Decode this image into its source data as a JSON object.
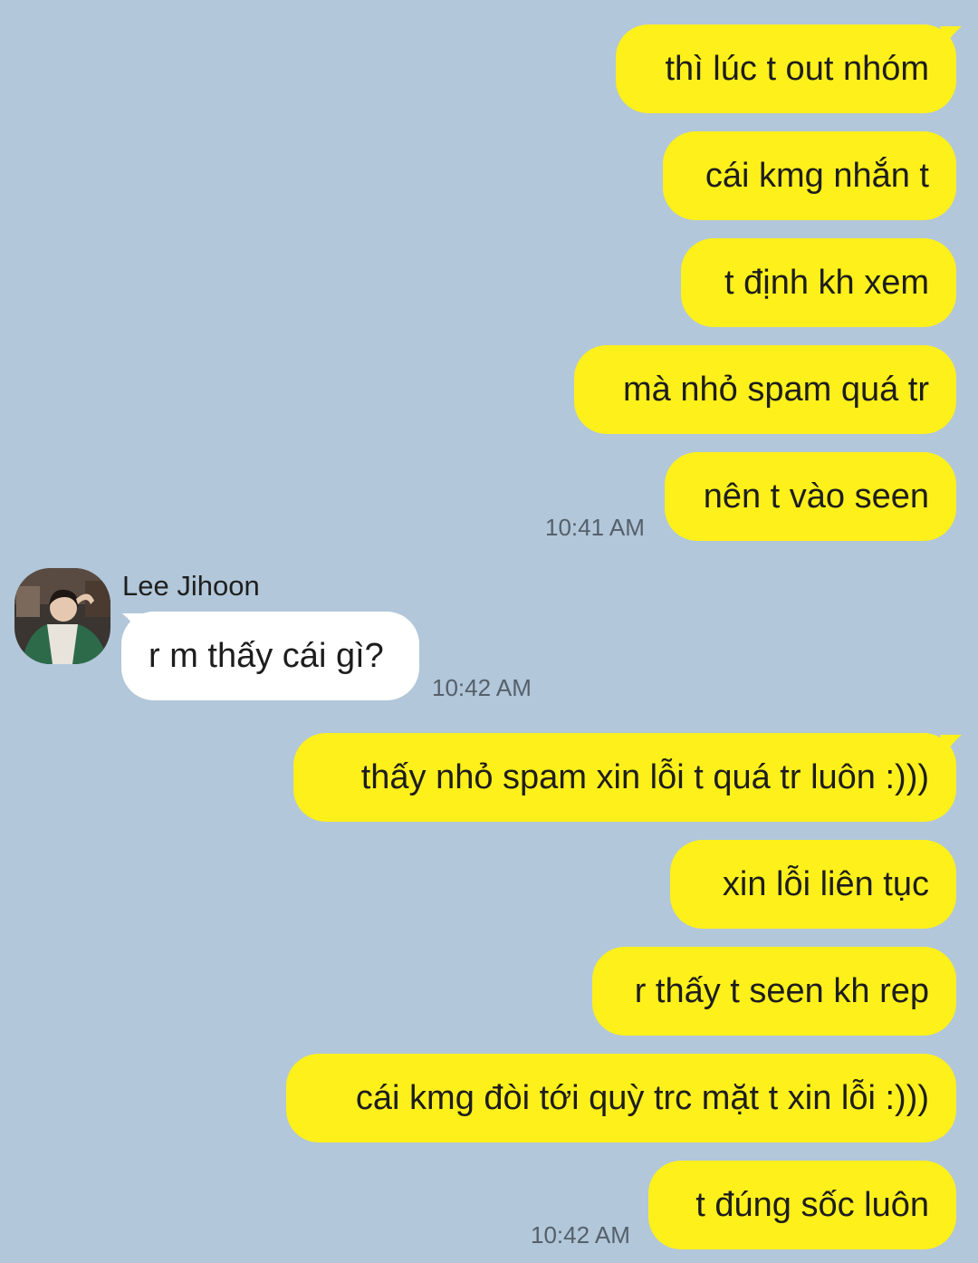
{
  "messages": [
    {
      "text": "thì lúc t out nhóm"
    },
    {
      "text": "cái kmg nhắn t"
    },
    {
      "text": "t định kh xem"
    },
    {
      "text": "mà nhỏ spam quá tr"
    },
    {
      "text": "nên t vào seen"
    },
    {
      "text": "r m thấy cái gì?"
    },
    {
      "text": "thấy nhỏ spam xin lỗi t quá tr luôn :)))"
    },
    {
      "text": "xin lỗi liên tục"
    },
    {
      "text": "r thấy t seen kh rep"
    },
    {
      "text": "cái kmg đòi tới quỳ trc mặt t xin lỗi :)))"
    },
    {
      "text": "t đúng sốc luôn"
    }
  ],
  "timestamps": {
    "group1": "10:41 AM",
    "incoming": "10:42 AM",
    "group2": "10:42 AM"
  },
  "contact": {
    "name": "Lee Jihoon",
    "avatar_icon": "contact-avatar-photo-icon"
  },
  "colors": {
    "background": "#b2c7d9",
    "outgoing_bubble": "#fef01b",
    "incoming_bubble": "#ffffff"
  }
}
